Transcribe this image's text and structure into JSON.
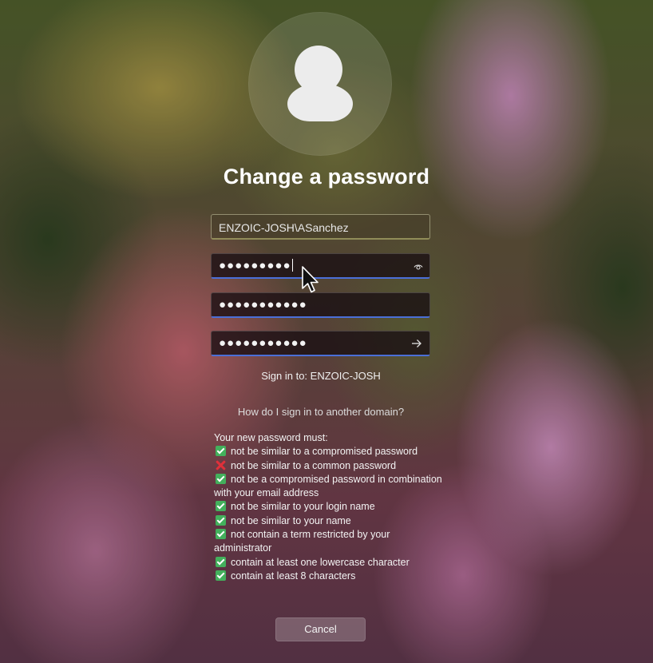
{
  "screen": {
    "title": "Change a password",
    "avatar_icon": "user-avatar-icon"
  },
  "form": {
    "username_value": "ENZOIC-JOSH\\ASanchez",
    "old_password_masked": "●●●●●●●●●",
    "new_password_masked": "●●●●●●●●●●●",
    "confirm_password_masked": "●●●●●●●●●●●",
    "reveal_icon": "eye-icon",
    "submit_icon": "arrow-right-icon",
    "accent_color": "#4a6fd8"
  },
  "signin": {
    "target": "Sign in to: ENZOIC-JOSH",
    "other_domain_link": "How do I sign in to another domain?"
  },
  "requirements": {
    "heading": "Your new password must:",
    "items": [
      {
        "text": "not be similar to a compromised password",
        "status": "pass"
      },
      {
        "text": "not be similar to a common password",
        "status": "fail"
      },
      {
        "text": "not be a compromised password in combination with your email address",
        "status": "pass"
      },
      {
        "text": "not be similar to your login name",
        "status": "pass"
      },
      {
        "text": "not be similar to your name",
        "status": "pass"
      },
      {
        "text": "not contain a term restricted by your administrator",
        "status": "pass"
      },
      {
        "text": "contain at least one lowercase character",
        "status": "pass"
      },
      {
        "text": "contain at least 8 characters",
        "status": "pass"
      }
    ],
    "pass_color": "#43b05c",
    "fail_color": "#e0303a"
  },
  "actions": {
    "cancel_label": "Cancel"
  }
}
